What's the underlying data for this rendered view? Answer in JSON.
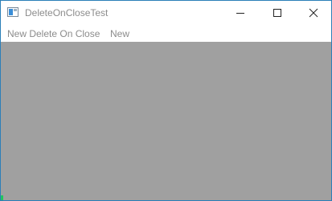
{
  "window": {
    "title": "DeleteOnCloseTest",
    "icon": "app-window-icon",
    "controls": {
      "minimize_icon": "minimize-icon",
      "maximize_icon": "maximize-icon",
      "close_icon": "close-icon"
    },
    "border_color": "#2b7fb8"
  },
  "menu": {
    "items": [
      {
        "label": "New Delete On Close"
      },
      {
        "label": "New"
      }
    ]
  },
  "client_area": {
    "background": "#a0a0a0"
  }
}
